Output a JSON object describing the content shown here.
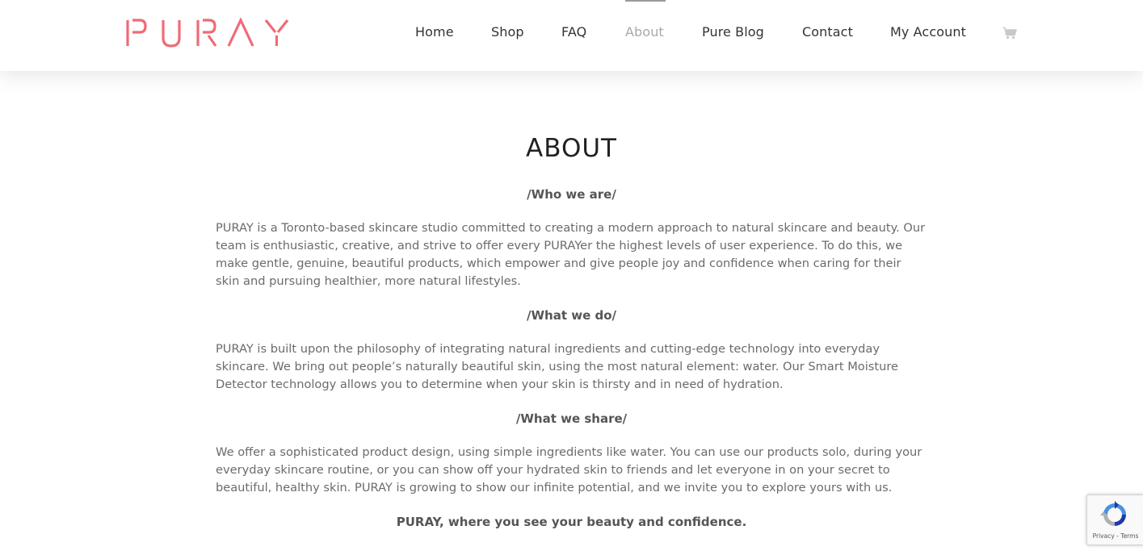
{
  "brand": {
    "logo_text": "PURAY",
    "accent_color": "#ef6b77"
  },
  "nav": {
    "items": [
      {
        "label": "Home"
      },
      {
        "label": "Shop"
      },
      {
        "label": "FAQ"
      },
      {
        "label": "About",
        "active": true
      },
      {
        "label": "Pure Blog"
      },
      {
        "label": "Contact"
      },
      {
        "label": "My Account"
      }
    ],
    "cart_icon": "cart-icon"
  },
  "main": {
    "title": "ABOUT",
    "sections": [
      {
        "heading": "/Who we are/",
        "body": "PURAY is a Toronto-based skincare studio committed to creating a modern approach to natural skincare and beauty. Our team is enthusiastic, creative, and strive to offer every PURAYer the highest levels of user experience. To do this, we make gentle, genuine, beautiful products, which empower and give people joy and confidence when caring for their skin and pursuing healthier, more natural lifestyles."
      },
      {
        "heading": "/What we do/",
        "body": "PURAY is built upon the philosophy of integrating natural ingredients and cutting-edge technology into everyday skincare. We bring out people’s naturally beautiful skin, using the most natural element: water. Our Smart Moisture Detector technology allows you to determine when your skin is thirsty and in need of hydration."
      },
      {
        "heading": "/What we share/",
        "body": "We offer a sophisticated product design, using simple ingredients like water. You can use our products solo, during your everyday skincare routine, or you can show off your hydrated skin to friends and let everyone in on your secret to beautiful, healthy skin. PURAY is growing to show our infinite potential, and we invite you to explore yours with us."
      }
    ],
    "tagline": "PURAY, where you see your beauty and confidence."
  },
  "recaptcha": {
    "privacy": "Privacy",
    "separator": " - ",
    "terms": "Terms"
  }
}
